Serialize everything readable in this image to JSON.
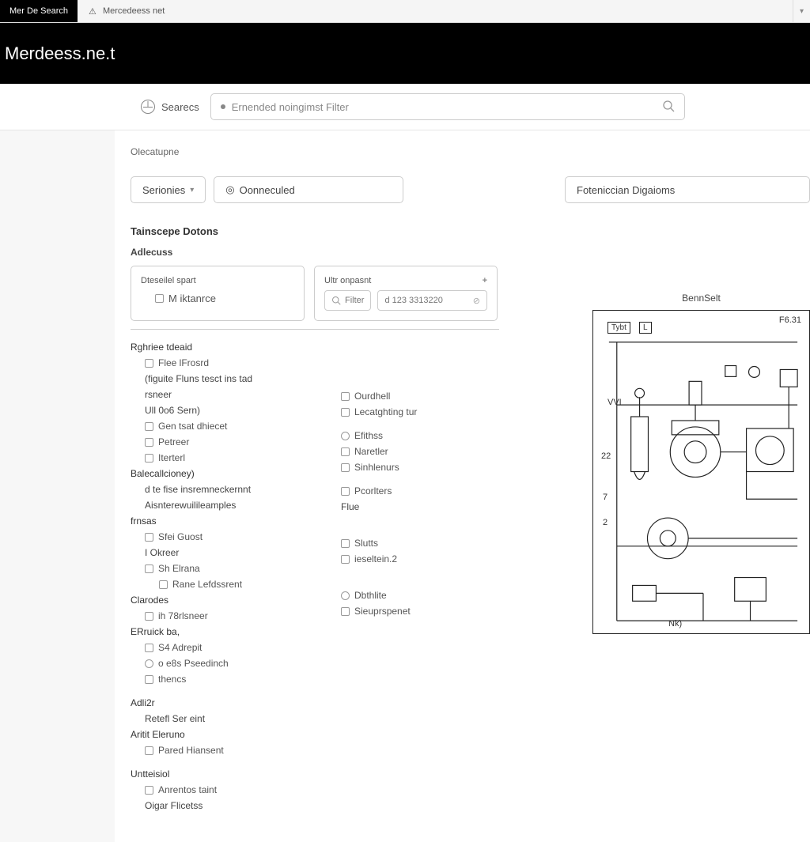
{
  "tabs": {
    "active": "Mer De Search",
    "inactive": "Mercedeess net"
  },
  "header": {
    "title": "Merdeess.ne.t"
  },
  "search": {
    "label": "Searecs",
    "placeholder": "Ernended noingimst Filter"
  },
  "breadcrumb": "Olecatupne",
  "filters": {
    "series": "Serionies",
    "connected": "Oonneculed",
    "diagrams": "Foteniccian Digaioms"
  },
  "section": {
    "title": "Tainscepe Dotons",
    "sub": "Adlecuss"
  },
  "panelA": {
    "head": "Dteseilel spart",
    "item": "M iktanrce"
  },
  "panelB": {
    "head": "Ultr onpasnt",
    "filter": "Filter",
    "code": "d 123 3313220"
  },
  "treeL": [
    {
      "t": "head",
      "txt": "Rghriee tdeaid"
    },
    {
      "t": "sub",
      "cb": true,
      "txt": "Flee lFrosrd"
    },
    {
      "t": "plain",
      "txt": "(figuite Fluns tesct ins tad"
    },
    {
      "t": "plain",
      "txt": "rsneer"
    },
    {
      "t": "plain",
      "txt": "Ull 0o6 Sern)"
    },
    {
      "t": "sub",
      "cb": true,
      "txt": "Gen tsat dhiecet"
    },
    {
      "t": "sub",
      "cb": true,
      "txt": "Petreer"
    },
    {
      "t": "sub",
      "cb": true,
      "txt": "Iterterl"
    },
    {
      "t": "head",
      "txt": "Balecallcioney)"
    },
    {
      "t": "plain",
      "txt": "d te fise insremneckernnt"
    },
    {
      "t": "plain",
      "txt": "Aisnterewuilileamples"
    },
    {
      "t": "head",
      "txt": "frnsas"
    },
    {
      "t": "sub",
      "cb": true,
      "txt": "Sfei Guost"
    },
    {
      "t": "plain",
      "txt": "I Okreer"
    },
    {
      "t": "sub",
      "cb": true,
      "txt": "Sh Elrana"
    },
    {
      "t": "sub2",
      "cb": true,
      "txt": "Rane Lefdssrent"
    },
    {
      "t": "head",
      "txt": "Clarodes"
    },
    {
      "t": "sub",
      "cb": true,
      "txt": "ih 78rlsneer"
    },
    {
      "t": "head",
      "txt": "ERruick ba,"
    },
    {
      "t": "sub",
      "cb": true,
      "txt": "S4 Adrepit"
    },
    {
      "t": "sub",
      "rb": true,
      "txt": "o e8s Pseedinch"
    },
    {
      "t": "sub",
      "cb": true,
      "txt": "thencs"
    },
    {
      "t": "spacer"
    },
    {
      "t": "head",
      "txt": "Adli2r"
    },
    {
      "t": "plain",
      "txt": "Retefl Ser eint"
    },
    {
      "t": "head",
      "txt": "Aritit Eleruno"
    },
    {
      "t": "sub",
      "cb": true,
      "txt": "Pared Hiansent"
    },
    {
      "t": "spacer"
    },
    {
      "t": "head",
      "txt": "Untteisiol"
    },
    {
      "t": "sub",
      "cb": true,
      "txt": "Anrentos taint"
    },
    {
      "t": "plain",
      "txt": "Oigar Flicetss"
    }
  ],
  "treeR": [
    {
      "t": "sub",
      "cb": true,
      "txt": "Ourdhell"
    },
    {
      "t": "sub",
      "cb": true,
      "txt": "Lecatghting tur"
    },
    {
      "t": "spacer"
    },
    {
      "t": "sub",
      "rb": true,
      "txt": "Efithss"
    },
    {
      "t": "sub",
      "cb": true,
      "txt": "Naretler"
    },
    {
      "t": "sub",
      "cb": true,
      "txt": "Sinhlenurs"
    },
    {
      "t": "spacer"
    },
    {
      "t": "sub",
      "cb": true,
      "txt": "Pcorlters"
    },
    {
      "t": "plain",
      "txt": "Flue"
    },
    {
      "t": "spacer2"
    },
    {
      "t": "sub",
      "cb": true,
      "txt": "Slutts"
    },
    {
      "t": "sub",
      "cb": true,
      "txt": "ieseltein.2"
    },
    {
      "t": "spacer2"
    },
    {
      "t": "sub",
      "rb": true,
      "txt": "Dbthlite"
    },
    {
      "t": "sub",
      "cb": true,
      "txt": "Sieuprspenet"
    }
  ],
  "diagram": {
    "title": "BennSelt",
    "box1": "Tybt",
    "box2": "L",
    "pg": "F6.31",
    "l1": "VVI",
    "l2": "22",
    "l3": "7",
    "l4": "2",
    "l5": "Nk)"
  }
}
